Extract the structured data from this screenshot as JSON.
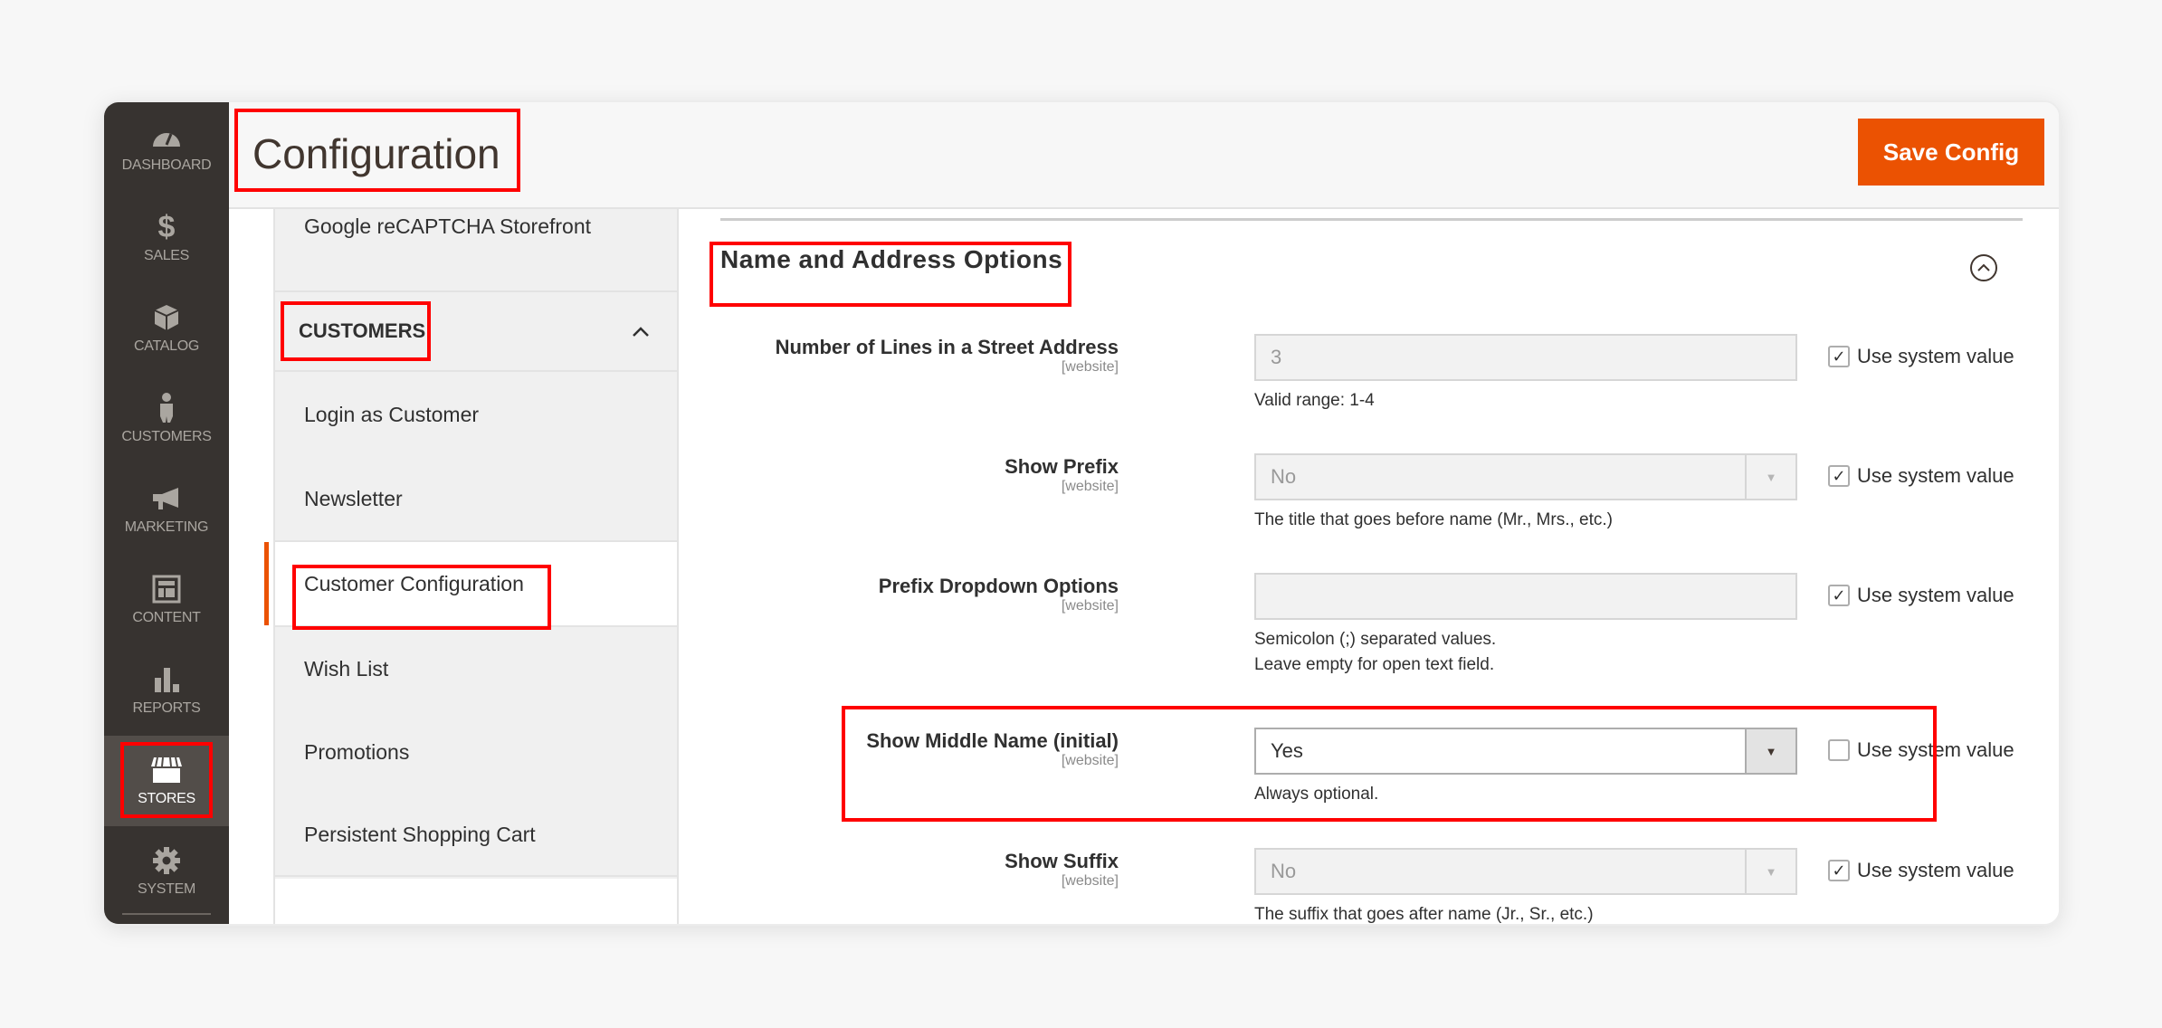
{
  "admin_menu": [
    {
      "label": "Dashboard",
      "icon": "dashboard-icon",
      "active": false
    },
    {
      "label": "Sales",
      "icon": "dollar-icon",
      "active": false
    },
    {
      "label": "Catalog",
      "icon": "box-icon",
      "active": false
    },
    {
      "label": "Customers",
      "icon": "person-icon",
      "active": false
    },
    {
      "label": "Marketing",
      "icon": "megaphone-icon",
      "active": false
    },
    {
      "label": "Content",
      "icon": "layout-icon",
      "active": false
    },
    {
      "label": "Reports",
      "icon": "bar-chart-icon",
      "active": false
    },
    {
      "label": "Stores",
      "icon": "storefront-icon",
      "active": true
    },
    {
      "label": "System",
      "icon": "gear-icon",
      "active": false
    }
  ],
  "header": {
    "title": "Configuration",
    "save_label": "Save Config"
  },
  "config_tabs": {
    "previous_item": "Google reCAPTCHA Storefront",
    "group_label": "CUSTOMERS",
    "group_expanded": true,
    "items": [
      {
        "label": "Login as Customer",
        "active": false
      },
      {
        "label": "Newsletter",
        "active": false
      },
      {
        "label": "Customer Configuration",
        "active": true
      },
      {
        "label": "Wish List",
        "active": false
      },
      {
        "label": "Promotions",
        "active": false
      },
      {
        "label": "Persistent Shopping Cart",
        "active": false
      }
    ]
  },
  "section": {
    "title": "Name and Address Options",
    "expanded": true,
    "fields": [
      {
        "label": "Number of Lines in a Street Address",
        "scope": "[website]",
        "type": "text",
        "value": "3",
        "enabled": false,
        "note": [
          "Valid range: 1-4"
        ],
        "use_system_value_label": "Use system value",
        "use_system_value": true
      },
      {
        "label": "Show Prefix",
        "scope": "[website]",
        "type": "select",
        "value": "No",
        "enabled": false,
        "note": [
          "The title that goes before name (Mr., Mrs., etc.)"
        ],
        "use_system_value_label": "Use system value",
        "use_system_value": true
      },
      {
        "label": "Prefix Dropdown Options",
        "scope": "[website]",
        "type": "text",
        "value": "",
        "enabled": false,
        "note": [
          "Semicolon (;) separated values.",
          "Leave empty for open text field."
        ],
        "use_system_value_label": "Use system value",
        "use_system_value": true
      },
      {
        "label": "Show Middle Name (initial)",
        "scope": "[website]",
        "type": "select",
        "value": "Yes",
        "enabled": true,
        "note": [
          "Always optional."
        ],
        "use_system_value_label": "Use system value",
        "use_system_value": false
      },
      {
        "label": "Show Suffix",
        "scope": "[website]",
        "type": "select",
        "value": "No",
        "enabled": false,
        "note": [
          "The suffix that goes after name (Jr., Sr., etc.)"
        ],
        "use_system_value_label": "Use system value",
        "use_system_value": true
      }
    ]
  },
  "colors": {
    "accent": "#eb5202",
    "menu_bg": "#373330",
    "highlight": "#ff0000"
  }
}
